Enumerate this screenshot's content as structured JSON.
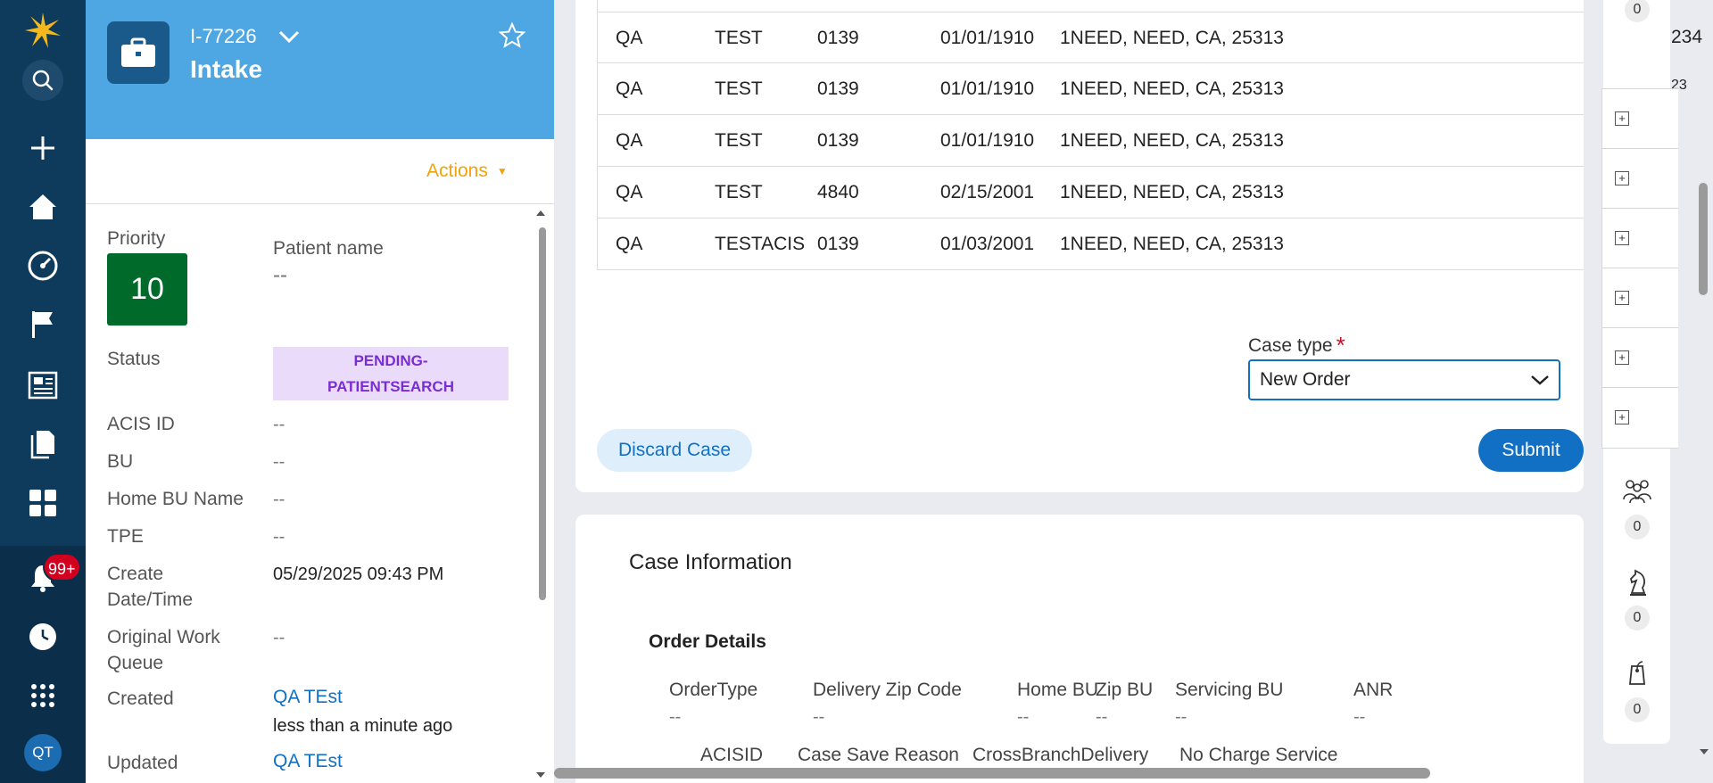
{
  "nav": {
    "notifications_badge": "99+",
    "avatar_initials": "QT",
    "icons": [
      "logo-icon",
      "search-icon",
      "plus-icon",
      "home-icon",
      "dashboard-icon",
      "flag-icon",
      "news-icon",
      "documents-icon",
      "apps-grid-icon",
      "bell-icon",
      "history-icon",
      "more-apps-icon"
    ]
  },
  "case": {
    "id": "I-77226",
    "title": "Intake",
    "actions_label": "Actions",
    "fields": {
      "priority_label": "Priority",
      "priority_value": "10",
      "patient_name_label": "Patient name",
      "patient_name_value": "--",
      "status_label": "Status",
      "status_value_line1": "PENDING-",
      "status_value_line2": "PATIENTSEARCH",
      "acis_id_label": "ACIS ID",
      "acis_id_value": "--",
      "bu_label": "BU",
      "bu_value": "--",
      "home_bu_name_label": "Home BU Name",
      "home_bu_name_value": "--",
      "tpe_label": "TPE",
      "tpe_value": "--",
      "create_dt_label_line1": "Create",
      "create_dt_label_line2": "Date/Time",
      "create_dt_value": "05/29/2025 09:43 PM",
      "owq_label_line1": "Original Work",
      "owq_label_line2": "Queue",
      "owq_value": "--",
      "created_label": "Created",
      "created_by": "QA TEst",
      "created_when": "less than a minute ago",
      "updated_label": "Updated",
      "updated_by": "QA TEst"
    }
  },
  "results": {
    "rows": [
      {
        "first": "QA",
        "last": "TEST",
        "ssn": "0139",
        "dob": "01/01/1910",
        "address": "1NEED, NEED, CA, 25313"
      },
      {
        "first": "QA",
        "last": "TEST",
        "ssn": "0139",
        "dob": "01/01/1910",
        "address": "1NEED, NEED, CA, 25313"
      },
      {
        "first": "QA",
        "last": "TEST",
        "ssn": "0139",
        "dob": "01/01/1910",
        "address": "1NEED, NEED, CA, 25313"
      },
      {
        "first": "QA",
        "last": "TEST",
        "ssn": "4840",
        "dob": "02/15/2001",
        "address": "1NEED, NEED, CA, 25313"
      },
      {
        "first": "QA",
        "last": "TESTACIS",
        "ssn": "0139",
        "dob": "01/03/2001",
        "address": "1NEED, NEED, CA, 25313"
      }
    ]
  },
  "form": {
    "case_type_label": "Case type",
    "required_mark": "*",
    "case_type_value": "New Order",
    "discard_label": "Discard Case",
    "submit_label": "Submit"
  },
  "case_info": {
    "title": "Case Information",
    "order_details_title": "Order Details",
    "fields": [
      {
        "label": "OrderType",
        "value": "--"
      },
      {
        "label": "Delivery Zip Code",
        "value": "--"
      },
      {
        "label": "Home BU",
        "value": "--"
      },
      {
        "label": "Zip BU",
        "value": "--"
      },
      {
        "label": "Servicing BU",
        "value": "--"
      },
      {
        "label": "ANR",
        "value": "--"
      }
    ],
    "fields_row2": [
      "ACISID",
      "Case Save Reason",
      "CrossBranchDelivery",
      "No Charge Service"
    ]
  },
  "rail": {
    "counts": [
      "0",
      "0",
      "0",
      "0"
    ],
    "clipped_text_1": "234",
    "clipped_text_2": "23"
  },
  "colors": {
    "nav": "#0e3a5c",
    "header": "#4ea6e2",
    "priority": "#006a2b",
    "status_bg": "#eadbfa",
    "status_fg": "#7a2dd1",
    "accent": "#1170c4",
    "actions": "#f0a30a"
  }
}
